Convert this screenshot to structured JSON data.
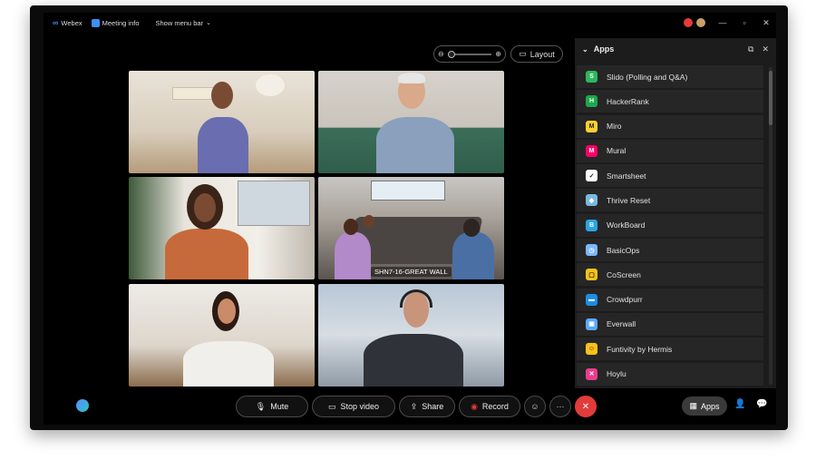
{
  "titlebar": {
    "app_name": "Webex",
    "meeting_info": "Meeting info",
    "show_menu_bar": "Show menu bar"
  },
  "controls": {
    "layout_label": "Layout"
  },
  "tiles": [
    {
      "label": ""
    },
    {
      "label": ""
    },
    {
      "label": ""
    },
    {
      "label": "SHN7-16-GREAT WALL"
    },
    {
      "label": ""
    },
    {
      "label": ""
    }
  ],
  "apps_panel": {
    "title": "Apps",
    "items": [
      {
        "name": "Slido (Polling and Q&A)",
        "icon": "slido-icon",
        "color": "#2eb85c",
        "glyph": "S"
      },
      {
        "name": "HackerRank",
        "icon": "hackerrank-icon",
        "color": "#1ba94c",
        "glyph": "H"
      },
      {
        "name": "Miro",
        "icon": "miro-icon",
        "color": "#ffd02f",
        "glyph": "M"
      },
      {
        "name": "Mural",
        "icon": "mural-icon",
        "color": "#ff0066",
        "glyph": "M"
      },
      {
        "name": "Smartsheet",
        "icon": "smartsheet-icon",
        "color": "#ffffff",
        "glyph": "✓"
      },
      {
        "name": "Thrive Reset",
        "icon": "thrive-reset-icon",
        "color": "#7ab8e0",
        "glyph": "◆"
      },
      {
        "name": "WorkBoard",
        "icon": "workboard-icon",
        "color": "#2aa4e6",
        "glyph": "B"
      },
      {
        "name": "BasicOps",
        "icon": "basicops-icon",
        "color": "#7ab8ff",
        "glyph": "◷"
      },
      {
        "name": "CoScreen",
        "icon": "coscreen-icon",
        "color": "#f5c21a",
        "glyph": "▢"
      },
      {
        "name": "Crowdpurr",
        "icon": "crowdpurr-icon",
        "color": "#1c8ee6",
        "glyph": "▬"
      },
      {
        "name": "Everwall",
        "icon": "everwall-icon",
        "color": "#5ba8ff",
        "glyph": "▣"
      },
      {
        "name": "Funtivity by Hermis",
        "icon": "funtivity-icon",
        "color": "#f7c21a",
        "glyph": "☺"
      },
      {
        "name": "Hoylu",
        "icon": "hoylu-icon",
        "color": "#e83e8c",
        "glyph": "✕"
      }
    ]
  },
  "bottom": {
    "mute": "Mute",
    "stop_video": "Stop video",
    "share": "Share",
    "record": "Record",
    "more": "···",
    "apps": "Apps"
  }
}
